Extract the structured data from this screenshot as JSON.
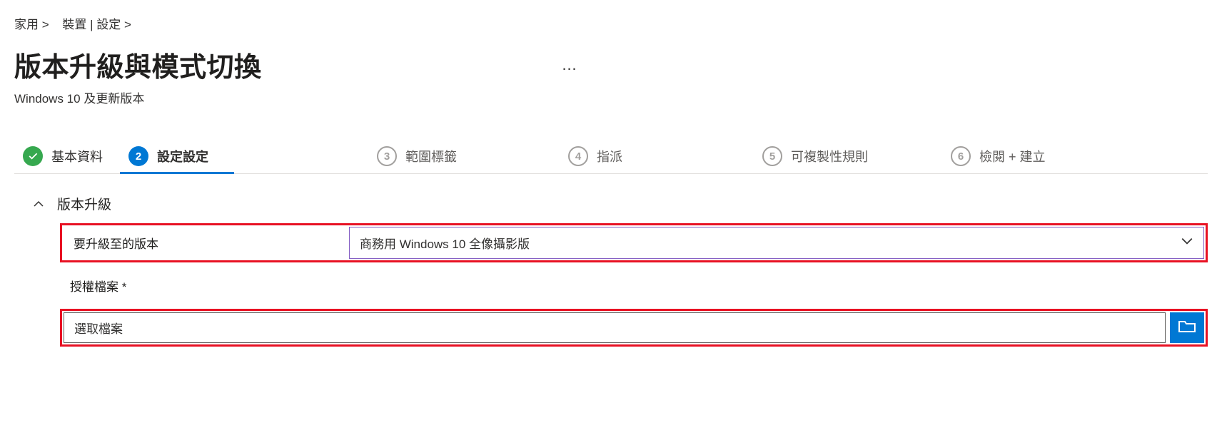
{
  "breadcrumb": {
    "item1": "家用 >",
    "item2": "裝置 | 設定 >"
  },
  "page": {
    "title": "版本升級與模式切換",
    "subtitle": "Windows 10 及更新版本",
    "more": "…"
  },
  "wizard": {
    "step1": {
      "label": "基本資料"
    },
    "step2": {
      "num": "2",
      "label": "設定設定"
    },
    "step3": {
      "num": "3",
      "label": "範圍標籤"
    },
    "step4": {
      "num": "4",
      "label": "指派"
    },
    "step5": {
      "num": "5",
      "label": "可複製性規則"
    },
    "step6": {
      "num": "6",
      "label": "檢閱 + 建立"
    }
  },
  "section": {
    "title": "版本升級"
  },
  "fields": {
    "edition_label": "要升級至的版本",
    "edition_value": "商務用 Windows 10 全像攝影版",
    "license_label": "授權檔案 *",
    "file_placeholder": "選取檔案"
  }
}
